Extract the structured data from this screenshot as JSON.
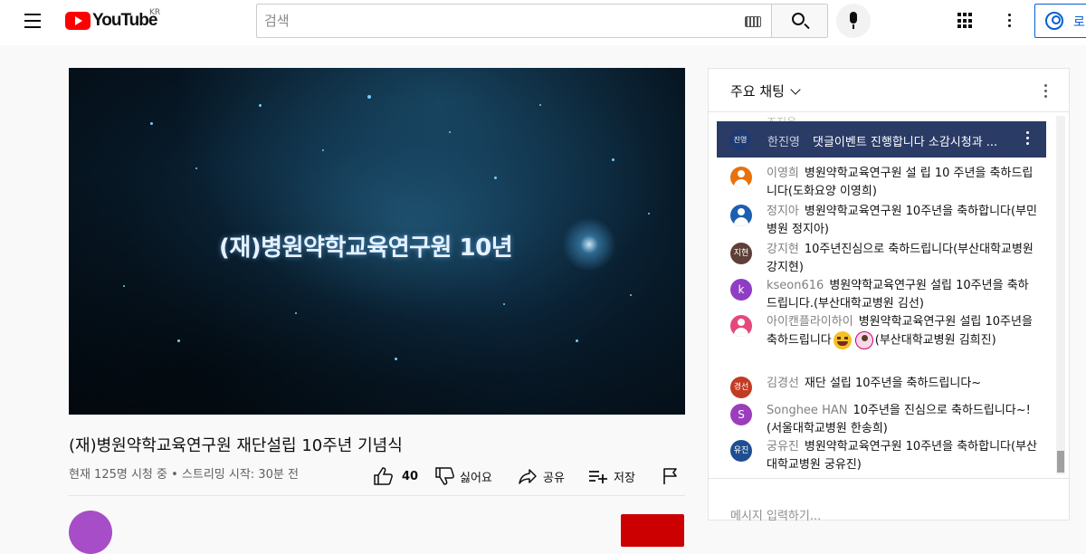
{
  "header": {
    "logo_text": "YouTube",
    "country_code": "KR",
    "search_placeholder": "검색",
    "signin_label": "로"
  },
  "video": {
    "overlay_title": "(재)병원약학교육연구원 10년",
    "title": "(재)병원약학교육연구원 재단설립 10주년 기념식",
    "stats": "현재 125명 시청 중 • 스트리밍 시작: 30분 전",
    "actions": {
      "like_count": "40",
      "dislike_label": "싫어요",
      "share_label": "공유",
      "save_label": "저장"
    }
  },
  "chat": {
    "mode_label": "주요 채팅",
    "faded_author": "조지은",
    "pinned": {
      "avatar_text": "진영",
      "author": "한진영",
      "text": "댓글이벤트 진행합니다 소감시청과 ..."
    },
    "messages": [
      {
        "author": "이영희",
        "text": "병원약학교육연구원 설 립 10 주년을 축하드립니다(도화요양 이영희)",
        "avatar_text": "",
        "avatar_color": "#e8710a"
      },
      {
        "author": "정지아",
        "text": "병원약학교육연구원 10주년을 축하합니다(부민병원 정지아)",
        "avatar_text": "",
        "avatar_color": "#1c5fb0"
      },
      {
        "author": "강지현",
        "text": "10주년진심으로 축하드립니다(부산대학교병원 강지현)",
        "avatar_text": "지현",
        "avatar_color": "#5d4037"
      },
      {
        "author": "kseon616",
        "text": "병원약학교육연구원 설립 10주년을 축하드립니다.(부산대학교병원 김선)",
        "avatar_text": "k",
        "avatar_color": "#8e3dc4"
      },
      {
        "author": "아이캔플라이하이",
        "text_before": "병원약학교육연구원 설립 10주년을 축하드립니다",
        "text_after": "(부산대학교병원 김희진)",
        "avatar_text": "",
        "avatar_color": "#e5487a"
      },
      {
        "author": "김경선",
        "text": "재단 설립 10주년을 축하드립니다~",
        "avatar_text": "경선",
        "avatar_color": "#c23b22"
      },
      {
        "author": "Songhee HAN",
        "text": "10주년을 진심으로 축하드립니다~!(서울대학교병원 한송희)",
        "avatar_text": "S",
        "avatar_color": "#9c3dbd"
      },
      {
        "author": "궁유진",
        "text": "병원약학교육연구원 10주년을 축하합니다(부산대학교병원 궁유진)",
        "avatar_text": "유진",
        "avatar_color": "#1f4e91"
      }
    ],
    "input_hint": "메시지 입력하기..."
  },
  "colors": {
    "brand_red": "#ff0000",
    "link_blue": "#065fd4",
    "pinned_bg": "#2a3b66"
  }
}
